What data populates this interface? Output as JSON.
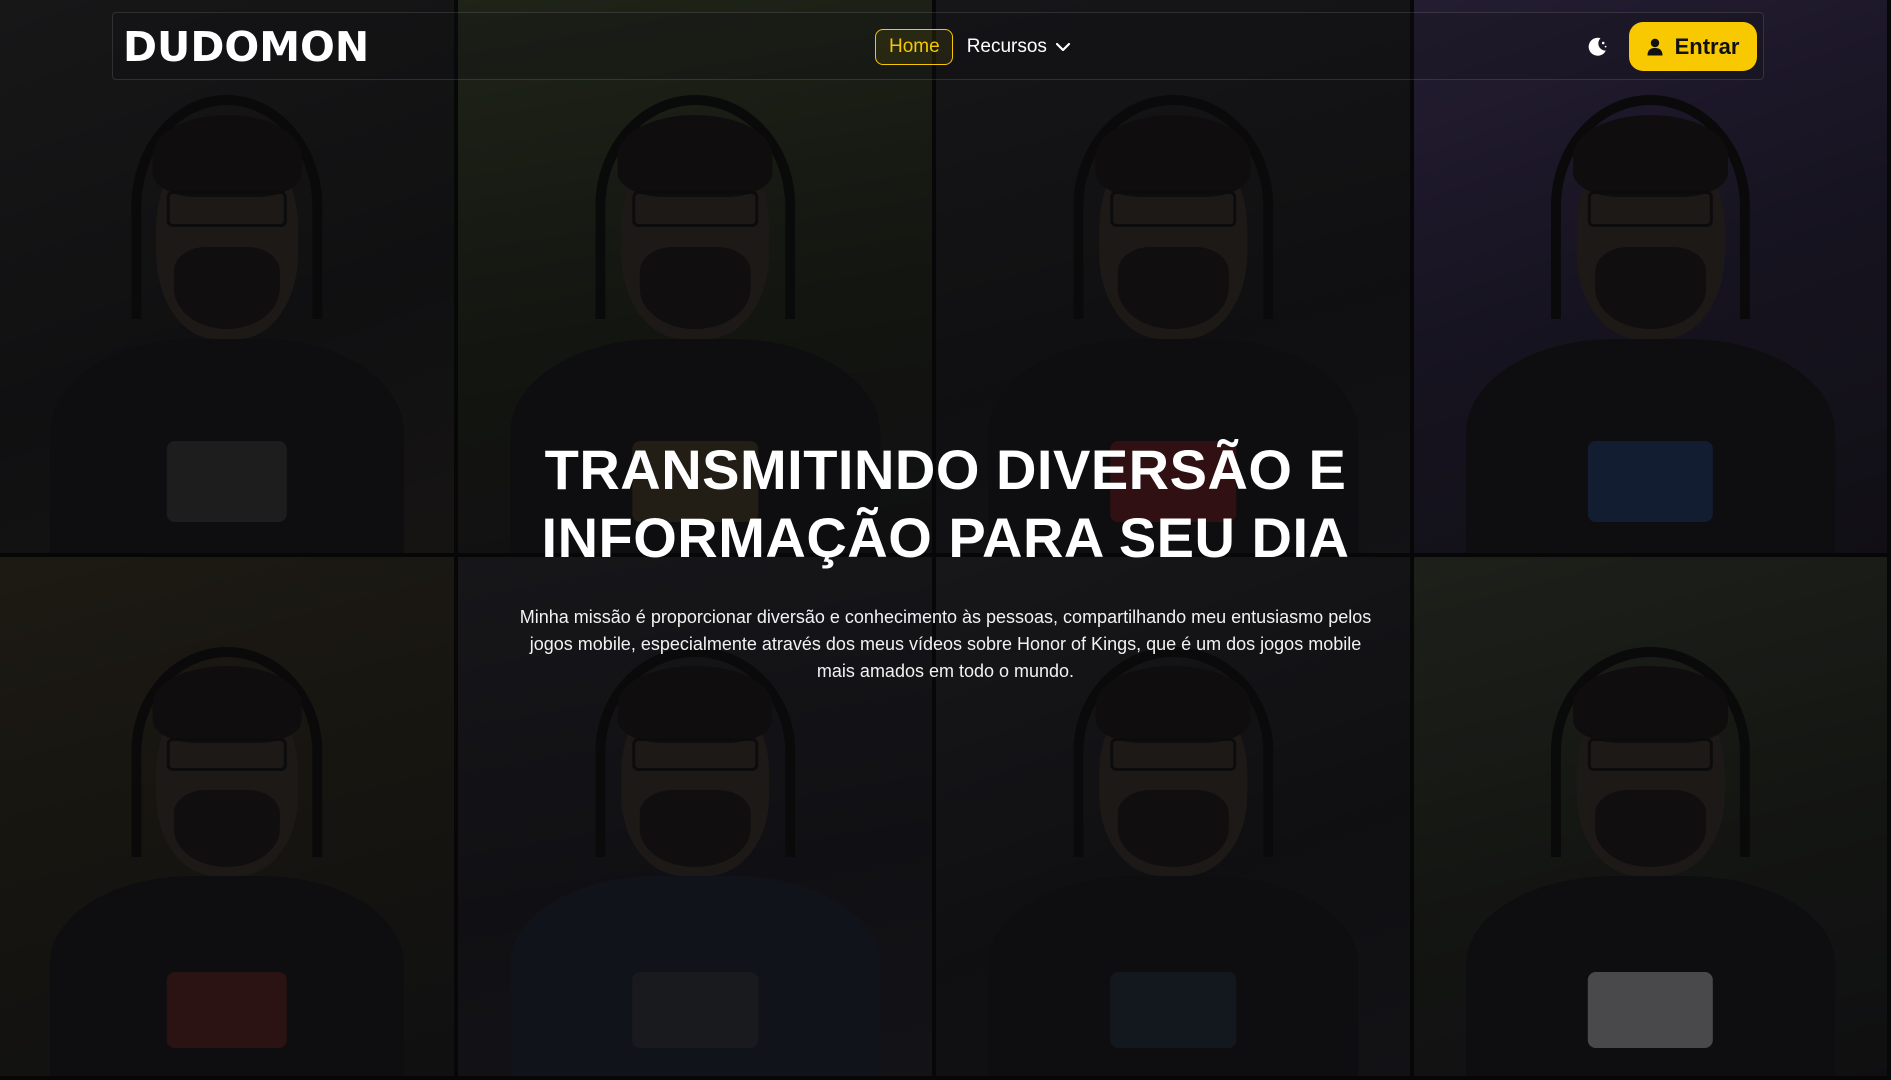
{
  "navbar": {
    "logo_text": "DUDOMON",
    "links": [
      {
        "label": "Home",
        "active": true
      },
      {
        "label": "Recursos",
        "has_dropdown": true,
        "icon": "chevron-down-icon"
      }
    ],
    "theme_toggle_icon": "moon-icon",
    "login": {
      "label": "Entrar",
      "icon": "user-icon"
    }
  },
  "hero": {
    "headline_line1": "TRANSMITINDO DIVERSÃO E",
    "headline_line2": "INFORMAÇÃO PARA SEU DIA",
    "description": "Minha missão é proporcionar diversão e conhecimento às pessoas, compartilhando meu entusiasmo pelos jogos mobile, especialmente através dos meus vídeos sobre Honor of Kings, que é um dos jogos mobile mais amados em todo o mundo."
  },
  "background_tiles_count": 8,
  "colors": {
    "accent": "#f8c800",
    "background": "#0c0c0e",
    "text": "#ffffff"
  }
}
